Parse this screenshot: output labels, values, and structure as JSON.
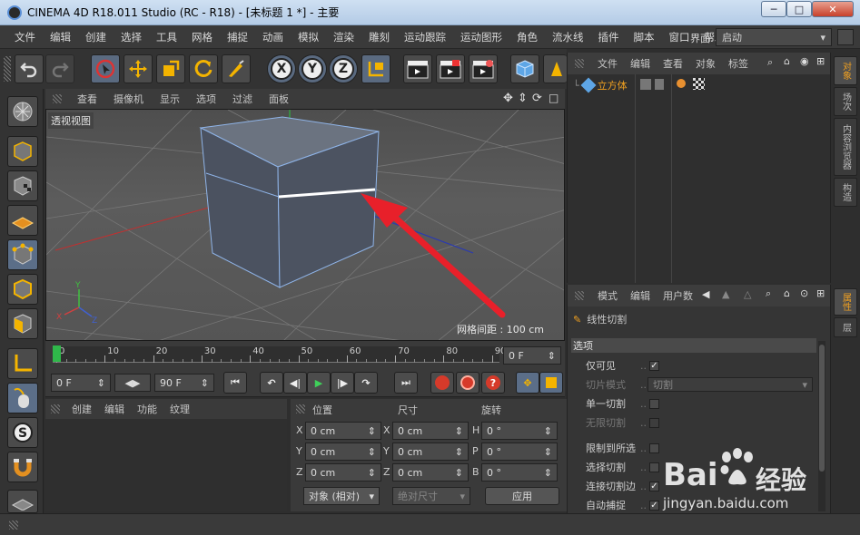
{
  "window": {
    "title": "CINEMA 4D R18.011 Studio (RC - R18) - [未标题 1 *] - 主要",
    "minimize_label": "─",
    "maximize_label": "□",
    "close_label": "✕"
  },
  "menubar": {
    "items": [
      "文件",
      "编辑",
      "创建",
      "选择",
      "工具",
      "网格",
      "捕捉",
      "动画",
      "模拟",
      "渲染",
      "雕刻",
      "运动跟踪",
      "运动图形",
      "角色",
      "流水线",
      "插件",
      "脚本",
      "窗口",
      "帮助"
    ],
    "layout_label": "界面:",
    "layout_value": "启动"
  },
  "toolbar": {
    "x_label": "X",
    "y_label": "Y",
    "z_label": "Z"
  },
  "viewport": {
    "menu": [
      "查看",
      "摄像机",
      "显示",
      "选项",
      "过滤",
      "面板"
    ],
    "label": "透视视图",
    "grid_info": "网格间距 : 100 cm"
  },
  "timeline": {
    "ticks": [
      "0",
      "10",
      "20",
      "30",
      "40",
      "50",
      "60",
      "70",
      "80",
      "90"
    ],
    "current_frame": "0 F",
    "start_frame": "0 F",
    "end_frame": "90 F"
  },
  "material_panel": {
    "menu": [
      "创建",
      "编辑",
      "功能",
      "纹理"
    ]
  },
  "coord_panel": {
    "headers": [
      "位置",
      "尺寸",
      "旋转"
    ],
    "rows": [
      {
        "axis": "X",
        "pos": "0 cm",
        "size_axis": "X",
        "size": "0 cm",
        "rot_axis": "H",
        "rot": "0 °"
      },
      {
        "axis": "Y",
        "pos": "0 cm",
        "size_axis": "Y",
        "size": "0 cm",
        "rot_axis": "P",
        "rot": "0 °"
      },
      {
        "axis": "Z",
        "pos": "0 cm",
        "size_axis": "Z",
        "size": "0 cm",
        "rot_axis": "B",
        "rot": "0 °"
      }
    ],
    "mode_select": "对象 (相对)",
    "size_select": "绝对尺寸",
    "apply_label": "应用"
  },
  "object_manager": {
    "menu": [
      "文件",
      "编辑",
      "查看",
      "对象",
      "标签"
    ],
    "objects": [
      {
        "name": "立方体"
      }
    ]
  },
  "attribute_manager": {
    "menu": [
      "模式",
      "编辑",
      "用户数"
    ],
    "tool_name": "线性切割",
    "section": "选项",
    "options": [
      {
        "label": "仅可见",
        "checked": true,
        "dim": false
      },
      {
        "label": "切片模式",
        "select": "切割",
        "dim": true
      },
      {
        "label": "单一切割",
        "checked": false,
        "dim": false
      },
      {
        "label": "无限切割",
        "checked": false,
        "dim": true
      },
      {
        "label": "限制到所选",
        "checked": false,
        "dim": false
      },
      {
        "label": "选择切割",
        "checked": false,
        "dim": false
      },
      {
        "label": "连接切割边",
        "checked": true,
        "dim": false
      },
      {
        "label": "自动捕捉",
        "checked": true,
        "dim": false
      }
    ]
  },
  "side_tabs_top": [
    "对象",
    "场次",
    "内容浏览器",
    "构造"
  ],
  "side_tabs_bottom": [
    "属性",
    "层"
  ],
  "watermark": {
    "brand": "Bai",
    "brand_cn": "经验",
    "url": "jingyan.baidu.com"
  },
  "colors": {
    "accent_orange": "#f0a020",
    "selection_blue": "#6fa8ff",
    "arrow_red": "#e8202a"
  }
}
